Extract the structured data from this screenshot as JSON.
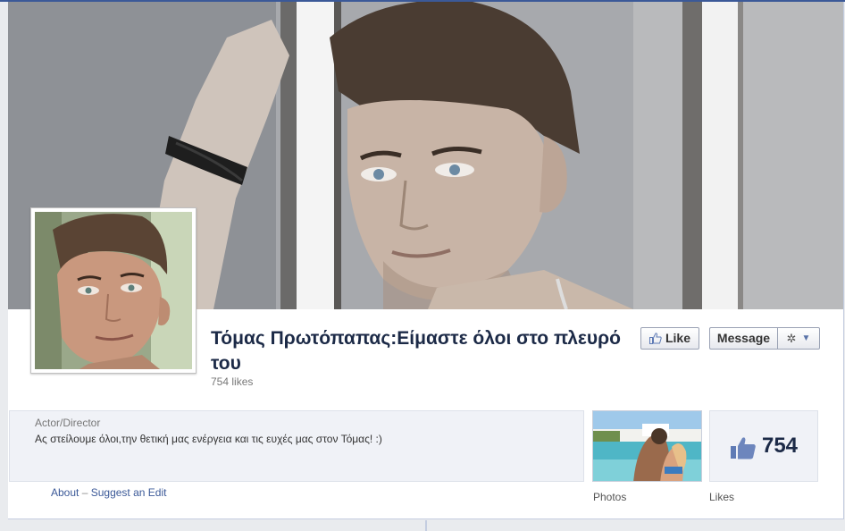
{
  "page": {
    "name": "Τόμας Πρωτόπαπας:Είμαστε όλοι στο πλευρό του",
    "likes_text": "754 likes",
    "category": "Actor/Director",
    "description": "Ας στείλουμε όλοι,την θετική μας ενέργεια και τις ευχές μας στον Τόμας! :)"
  },
  "actions": {
    "like_label": "Like",
    "message_label": "Message",
    "settings_icon": "gear-icon",
    "dropdown_icon": "caret-down-icon"
  },
  "links": {
    "about": "About",
    "separator": "–",
    "suggest_edit": "Suggest an Edit"
  },
  "apps": {
    "photos_label": "Photos",
    "likes_label": "Likes",
    "likes_count": "754"
  },
  "colors": {
    "brand": "#3b5998",
    "name_text": "#1c2a47",
    "box_bg": "#f0f2f7"
  }
}
